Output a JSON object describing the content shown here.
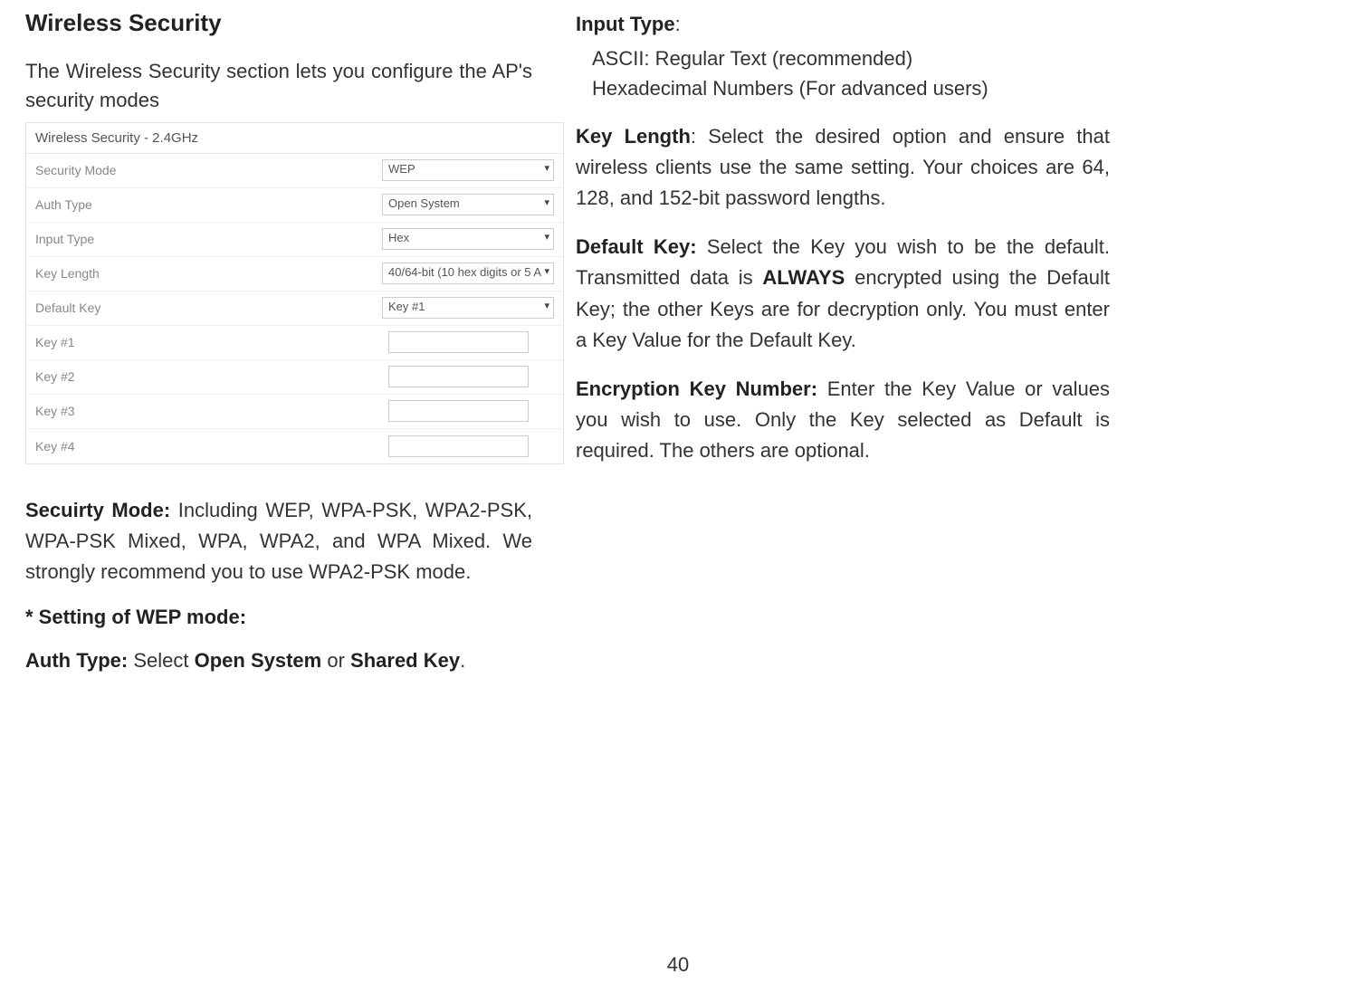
{
  "left": {
    "heading": "Wireless Security",
    "intro": "The Wireless Security section lets you configure the AP's security modes",
    "panel": {
      "title": "Wireless Security - 2.4GHz",
      "rows": [
        {
          "label": "Security Mode",
          "value": "WEP",
          "type": "select"
        },
        {
          "label": "Auth Type",
          "value": "Open System",
          "type": "select"
        },
        {
          "label": "Input Type",
          "value": "Hex",
          "type": "select"
        },
        {
          "label": "Key Length",
          "value": "40/64-bit (10 hex digits or 5 A",
          "type": "select"
        },
        {
          "label": "Default Key",
          "value": "Key #1",
          "type": "select"
        },
        {
          "label": "Key #1",
          "value": "",
          "type": "input"
        },
        {
          "label": "Key #2",
          "value": "",
          "type": "input"
        },
        {
          "label": "Key #3",
          "value": "",
          "type": "input"
        },
        {
          "label": "Key #4",
          "value": "",
          "type": "input"
        }
      ]
    },
    "security_mode_label": "Secuirty Mode:",
    "security_mode_text": " Including WEP, WPA-PSK, WPA2-PSK, WPA-PSK Mixed, WPA, WPA2, and WPA Mixed. We strongly recommend you to use WPA2-PSK mode.",
    "wep_heading": "* Setting of WEP mode:",
    "auth_type_label": "Auth Type:",
    "auth_type_mid": " Select ",
    "auth_type_b1": "Open System",
    "auth_type_mid2": " or ",
    "auth_type_b2": "Shared Key",
    "auth_type_end": "."
  },
  "right": {
    "input_type_label": "Input Type",
    "input_type_colon": ":",
    "input_type_items": [
      "ASCII: Regular Text (recommended)",
      "Hexadecimal Numbers (For advanced users)"
    ],
    "key_length_label": "Key Length",
    "key_length_text": ": Select the desired option and ensure that wireless clients use the same setting. Your choices are 64, 128, and 152-bit password lengths.",
    "default_key_label": "Default Key:",
    "default_key_pre": " Select the Key you wish to be the default. Transmitted data is ",
    "default_key_bold": "ALWAYS",
    "default_key_post": " encrypted using the Default Key; the other Keys are for decryption only. You must enter a Key Value for the Default Key.",
    "enc_key_label": "Encryption Key Number:",
    "enc_key_text": " Enter the Key Value or values you wish to use. Only the Key selected as Default is required. The others are optional."
  },
  "page_number": "40"
}
